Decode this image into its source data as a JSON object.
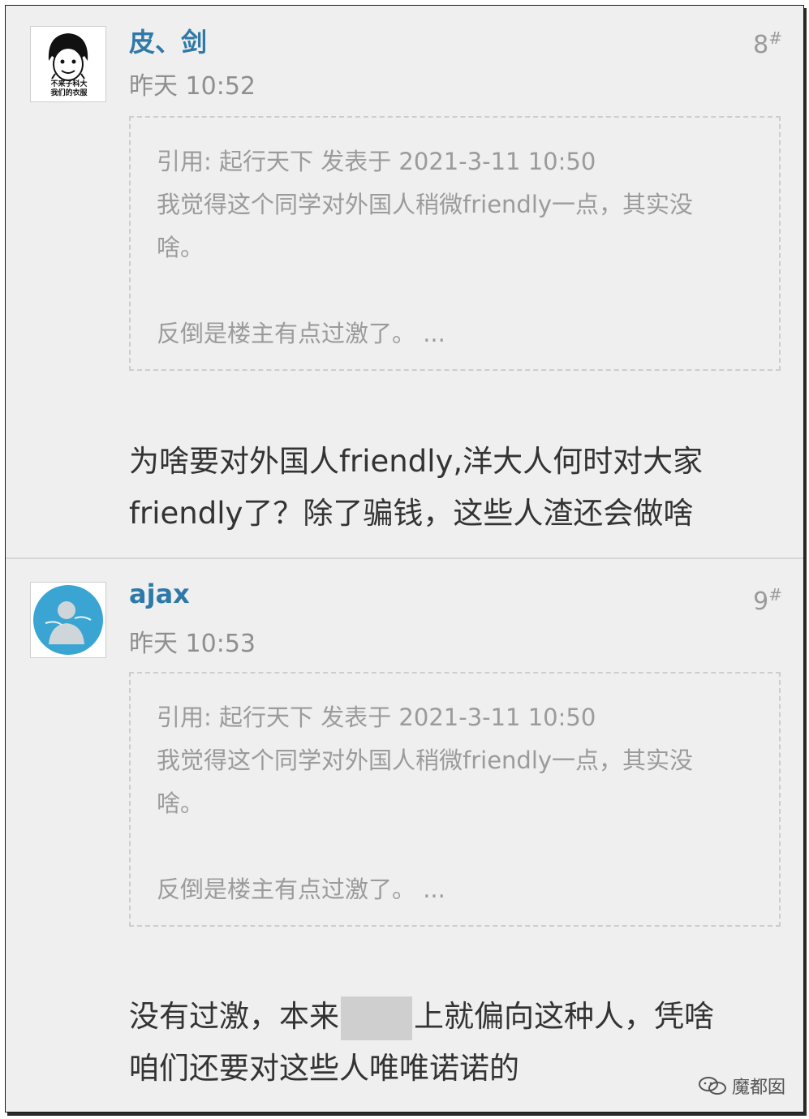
{
  "posts": [
    {
      "username": "皮、剑",
      "time": "昨天 10:52",
      "floor": "8",
      "floor_mark": "#",
      "avatar_caption": [
        "不来子科大",
        "我们的衣服"
      ],
      "quote": {
        "header": "引用: 起行天下 发表于 2021-3-11 10:50",
        "lines": [
          "我觉得这个同学对外国人稍微friendly一点，其实没",
          "啥。",
          "反倒是楼主有点过激了。 ..."
        ]
      },
      "reply": [
        "为啥要对外国人friendly,洋大人何时对大家",
        "friendly了？除了骗钱，这些人渣还会做啥"
      ]
    },
    {
      "username": "ajax",
      "time": "昨天 10:53",
      "floor": "9",
      "floor_mark": "#",
      "quote": {
        "header": "引用: 起行天下 发表于 2021-3-11 10:50",
        "lines": [
          "我觉得这个同学对外国人稍微friendly一点，其实没",
          "啥。",
          "反倒是楼主有点过激了。 ..."
        ]
      },
      "reply_line1_before": "没有过激，本来",
      "reply_line1_after": "上就偏向这种人，凭啥",
      "reply_line2": "咱们还要对这些人唯唯诺诺的"
    }
  ],
  "watermark": "魔都囡",
  "colors": {
    "username": "#2f79a8",
    "meta": "#8f8f8f",
    "quote_text": "#9b9b9b",
    "body_text": "#333333",
    "background": "#efefef",
    "avatar2_fill": "#3aa5d3"
  }
}
